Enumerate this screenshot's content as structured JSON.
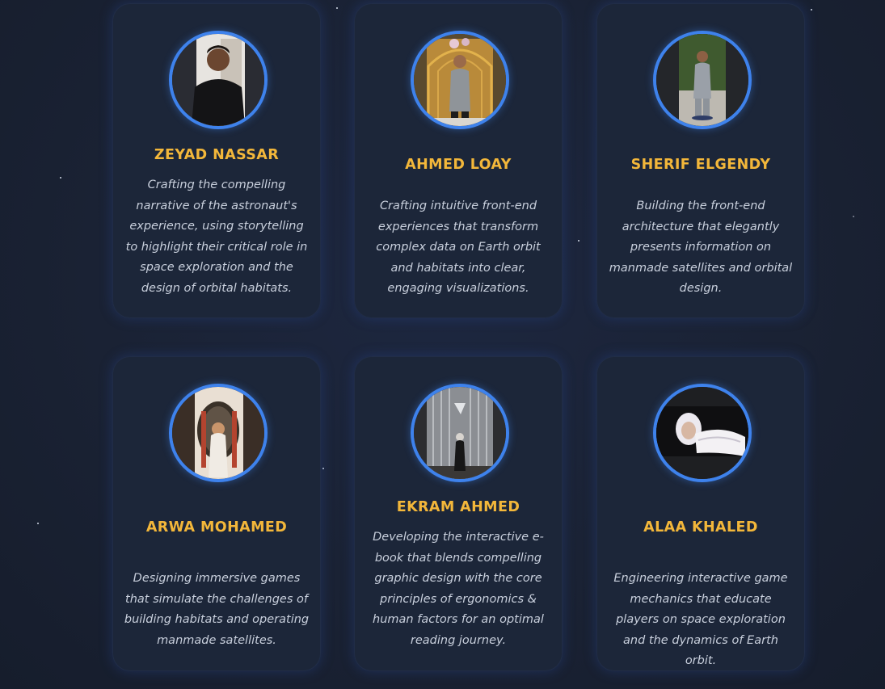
{
  "team": [
    {
      "name": "ZEYAD NASSAR",
      "description": "Crafting the compelling narrative of the astronaut's experience, using storytelling to highlight their critical role in space exploration and the design of orbital habitats.",
      "photo_icon": "portrait-photo"
    },
    {
      "name": "AHMED LOAY",
      "description": "Crafting intuitive front-end experiences that transform complex data on Earth orbit and habitats into clear, engaging visualizations.",
      "photo_icon": "portrait-photo"
    },
    {
      "name": "SHERIF ELGENDY",
      "description": "Building the front-end architecture that elegantly presents information on manmade satellites and orbital design.",
      "photo_icon": "portrait-photo"
    },
    {
      "name": "ARWA MOHAMED",
      "description": "Designing immersive games that simulate the challenges of building habitats and operating manmade satellites.",
      "photo_icon": "portrait-photo"
    },
    {
      "name": "EKRAM AHMED",
      "description": "Developing the interactive e-book that blends compelling graphic design with the core principles of ergonomics & human factors for an optimal reading journey.",
      "photo_icon": "portrait-photo"
    },
    {
      "name": "ALAA KHALED",
      "description": "Engineering interactive game mechanics that educate players on space exploration and the dynamics of Earth orbit.",
      "photo_icon": "portrait-photo"
    }
  ],
  "colors": {
    "background": "#1a2233",
    "card": "#1c2639",
    "name": "#f3b73a",
    "description": "#c8cfdc",
    "avatar_ring": "#3e82ec"
  }
}
